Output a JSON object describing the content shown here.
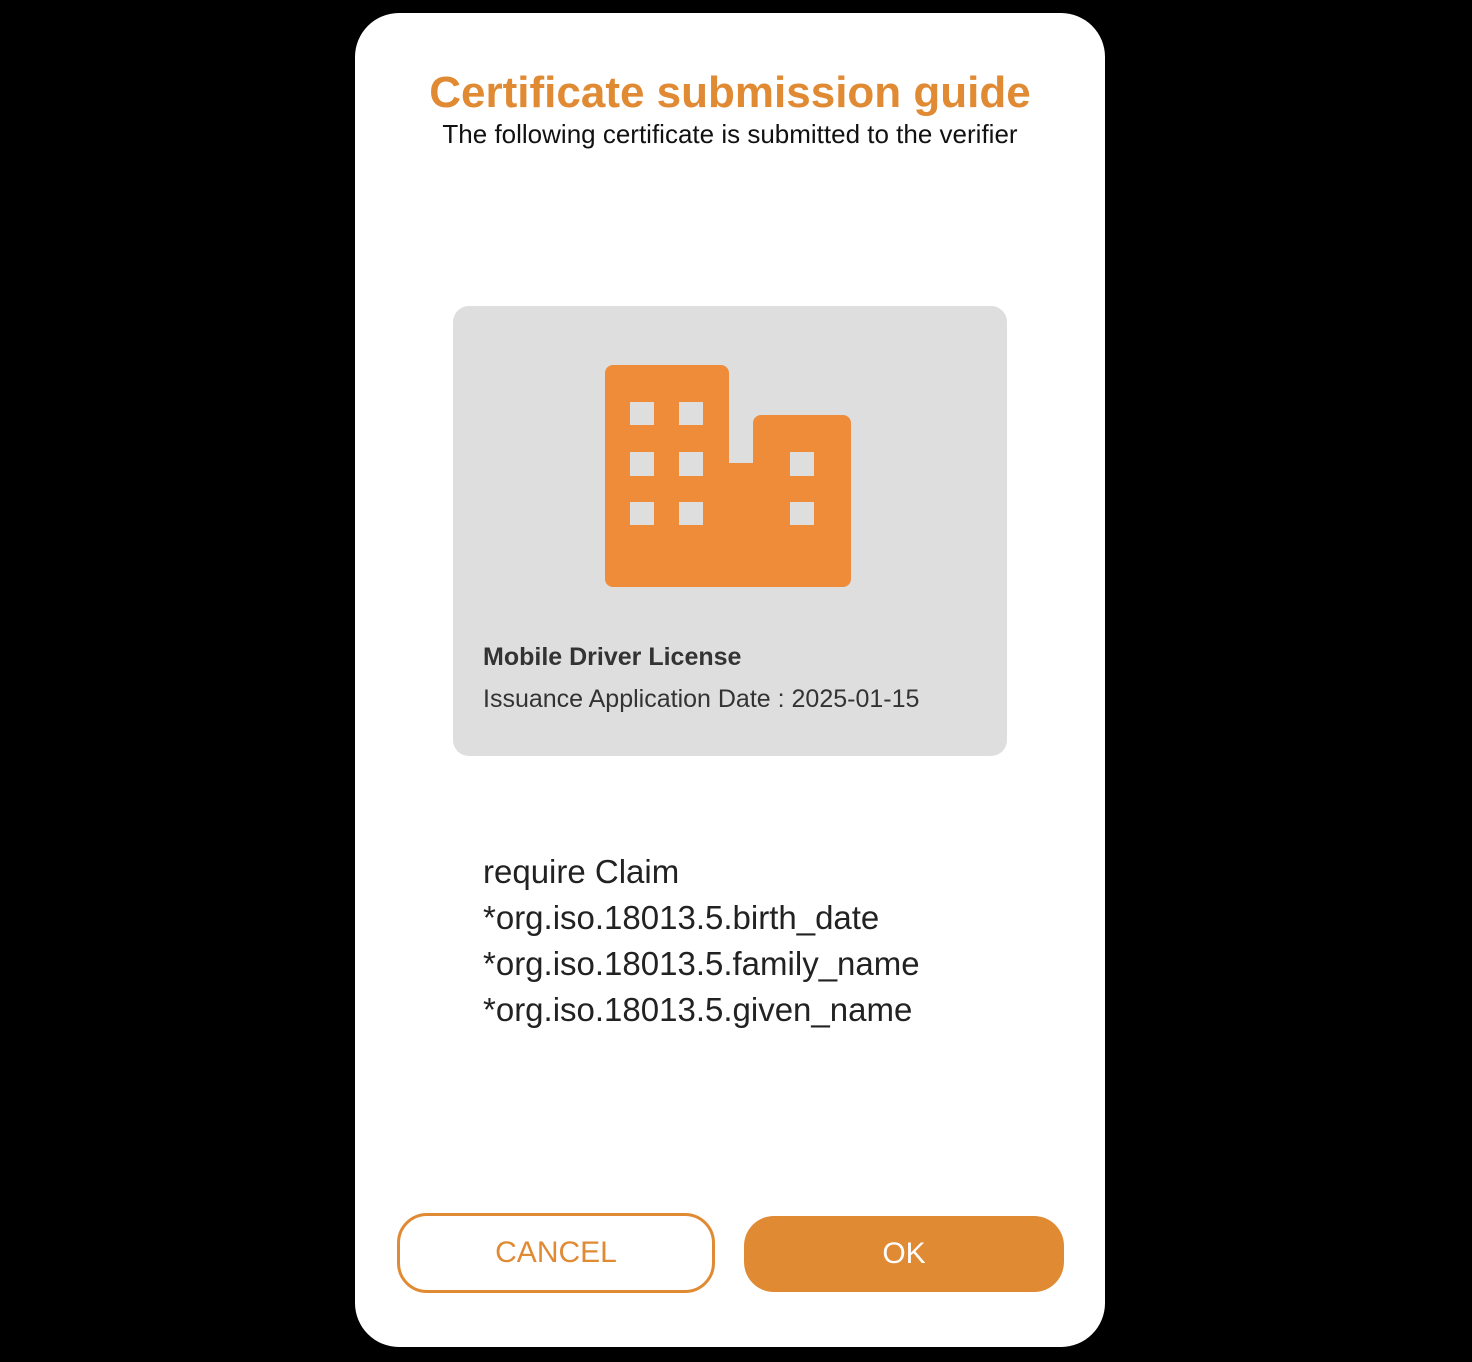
{
  "dialog": {
    "title": "Certificate submission guide",
    "subtitle": "The following certificate is submitted to the verifier"
  },
  "certificate": {
    "icon": "building-icon",
    "name": "Mobile Driver License",
    "issuance_date": "Issuance Application Date : 2025-01-15"
  },
  "claims": {
    "heading": "require Claim",
    "items": [
      "*org.iso.18013.5.birth_date",
      "*org.iso.18013.5.family_name",
      "*org.iso.18013.5.given_name"
    ]
  },
  "buttons": {
    "cancel_label": "CANCEL",
    "ok_label": "OK"
  },
  "colors": {
    "accent": "#e08a34",
    "icon_fill": "#ee8c3a",
    "card_background": "#dedede",
    "backdrop": "#000000"
  }
}
